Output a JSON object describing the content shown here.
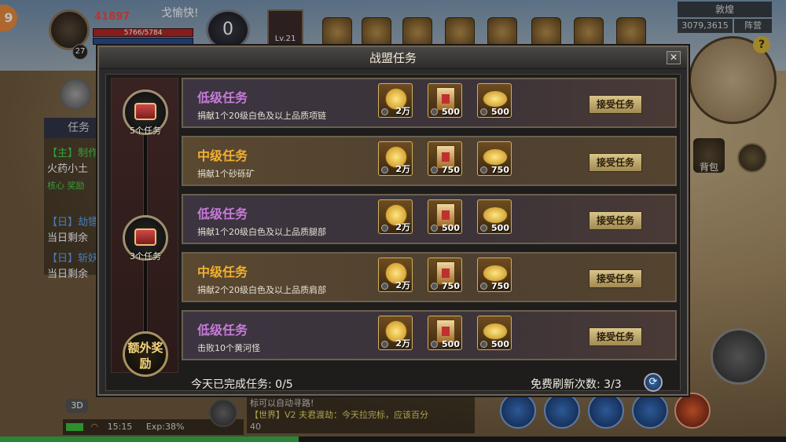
{
  "hud": {
    "level_badge": "9",
    "player_level": "27",
    "power": "41897",
    "hp": "5766/5784",
    "mp": "4522/4550",
    "chat_snippet": "戈愉快!",
    "emblem_value": "0",
    "target_level": "Lv.21",
    "location": "敦煌",
    "coords": "3079,3615",
    "camp": "阵营",
    "help": "?",
    "bag": "背包"
  },
  "left_panel": {
    "tab": "任务",
    "lines": [
      "【主】制作",
      "火药小土",
      "核心 奖励",
      "【日】劫镖",
      "当日剩余",
      "【日】斩妖",
      "当日剩余"
    ]
  },
  "bottom_bar": {
    "mode": "3D",
    "time": "15:15",
    "exp": "Exp:38%",
    "exp_percent": 38,
    "world_chat_line1": "标可以自动寻路!",
    "world_chat_line2": "【世界】V2 夫君渡劫：今天拉完标，应该百分",
    "world_chat_line3": "40"
  },
  "dialog": {
    "title": "战盟任务",
    "close": "✕",
    "chests": [
      {
        "label": "5个任务"
      },
      {
        "label": "3个任务"
      }
    ],
    "extra_reward": "额外奖励",
    "tasks": [
      {
        "name": "低级任务",
        "tier": "low",
        "desc": "捐献1个20级白色及以上品质项链",
        "rewards": [
          "2万",
          "500",
          "500"
        ],
        "button": "接受任务"
      },
      {
        "name": "中级任务",
        "tier": "mid",
        "desc": "捐献1个砂砾矿",
        "rewards": [
          "2万",
          "750",
          "750"
        ],
        "button": "接受任务"
      },
      {
        "name": "低级任务",
        "tier": "low",
        "desc": "捐献1个20级白色及以上品质腿部",
        "rewards": [
          "2万",
          "500",
          "500"
        ],
        "button": "接受任务"
      },
      {
        "name": "中级任务",
        "tier": "mid",
        "desc": "捐献2个20级白色及以上品质肩部",
        "rewards": [
          "2万",
          "750",
          "750"
        ],
        "button": "接受任务"
      },
      {
        "name": "低级任务",
        "tier": "low",
        "desc": "击败10个黄河怪",
        "rewards": [
          "2万",
          "500",
          "500"
        ],
        "button": "接受任务"
      }
    ],
    "footer_done_label": "今天已完成任务:",
    "footer_done_value": "0/5",
    "footer_refresh_label": "免费刷新次数:",
    "footer_refresh_value": "3/3"
  },
  "colors": {
    "low_task": "#c77bd9",
    "mid_task": "#f0b030",
    "accent_gold": "#d9c48a"
  }
}
